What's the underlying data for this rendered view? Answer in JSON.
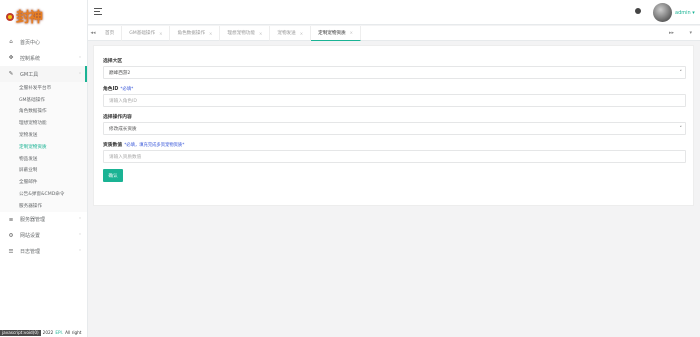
{
  "brand": {
    "logo_text": "封神"
  },
  "sidebar": {
    "items": [
      {
        "label": "首页中心",
        "icon": "home-icon",
        "glyph": "⌂"
      },
      {
        "label": "控制系统",
        "icon": "move-icon",
        "glyph": "✥"
      },
      {
        "label": "GM工具",
        "icon": "tool-icon",
        "glyph": "✎"
      },
      {
        "label": "服务器管理",
        "icon": "server-icon",
        "glyph": "≡"
      },
      {
        "label": "网站设置",
        "icon": "settings-icon",
        "glyph": "⚙"
      },
      {
        "label": "日志管理",
        "icon": "log-icon",
        "glyph": "☰"
      }
    ],
    "submenu": [
      "全服补发平台币",
      "GM基础操作",
      "角色数据操作",
      "理想宠物功能",
      "宠物发送",
      "定制宠物资质",
      "物品发送",
      "屏蔽业制",
      "全服邮件",
      "公告&弹窗&CMD命令",
      "服务器操作"
    ],
    "active_sub_index": 5
  },
  "footer": {
    "js_label": "javascript:void(0)",
    "year": "2022",
    "brand": "EPI.",
    "rights": "All right"
  },
  "header": {
    "username": "admin ▾"
  },
  "tabs": {
    "items": [
      {
        "label": "首页"
      },
      {
        "label": "GM基础操作"
      },
      {
        "label": "角色数据操作"
      },
      {
        "label": "理想宠物功能"
      },
      {
        "label": "宠物发送"
      },
      {
        "label": "定制宠物资质"
      }
    ],
    "active_index": 5,
    "nav_left": "◂◂",
    "nav_right": "▸▸",
    "close_menu": "▾"
  },
  "form": {
    "region_label": "选择大区",
    "region_value": "巅峰西游2",
    "role_label": "角色ID",
    "role_hint": "*必填*",
    "role_placeholder": "请输入角色ID",
    "op_label": "选择操作内容",
    "op_value": "修改成长资质",
    "value_label": "资质数值",
    "value_hint": "*必填，填充完成多资宠物资质*",
    "value_placeholder": "请输入资质数值",
    "submit_label": "确认"
  },
  "colors": {
    "accent": "#1ab394",
    "hint": "#3353d8"
  }
}
